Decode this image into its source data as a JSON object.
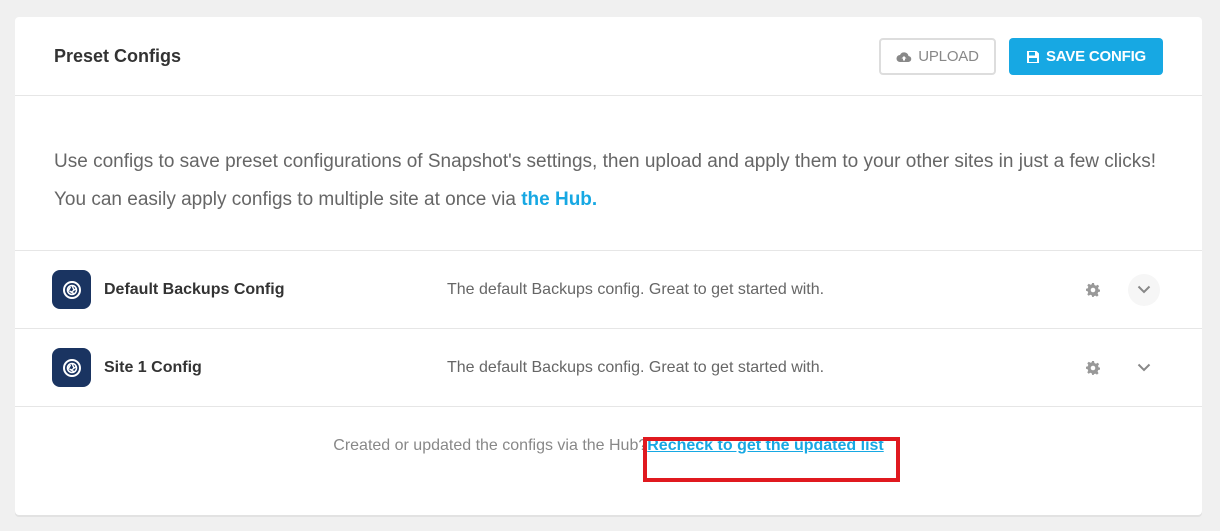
{
  "header": {
    "title": "Preset Configs",
    "upload_label": "UPLOAD",
    "save_label": "SAVE CONFIG"
  },
  "intro": {
    "line1": "Use configs to save preset configurations of Snapshot's settings, then upload and apply them to your other sites in just a few clicks!",
    "line2_prefix": "You can easily apply configs to multiple site at once via ",
    "hub_link": "the Hub."
  },
  "configs": [
    {
      "name": "Default Backups Config",
      "description": "The default Backups config. Great to get started with."
    },
    {
      "name": "Site 1 Config",
      "description": "The default Backups config. Great to get started with."
    }
  ],
  "footer": {
    "prefix": "Created or updated the configs via the Hub?",
    "recheck_link": "Recheck to get the updated list"
  },
  "colors": {
    "accent": "#17a8e3",
    "config_icon_bg": "#1a3461",
    "highlight": "#e0191f"
  },
  "icons": {
    "upload": "cloud-upload-icon",
    "save": "floppy-disk-icon",
    "config": "snapshot-logo-icon",
    "settings": "gear-icon",
    "expand": "chevron-down-icon"
  }
}
